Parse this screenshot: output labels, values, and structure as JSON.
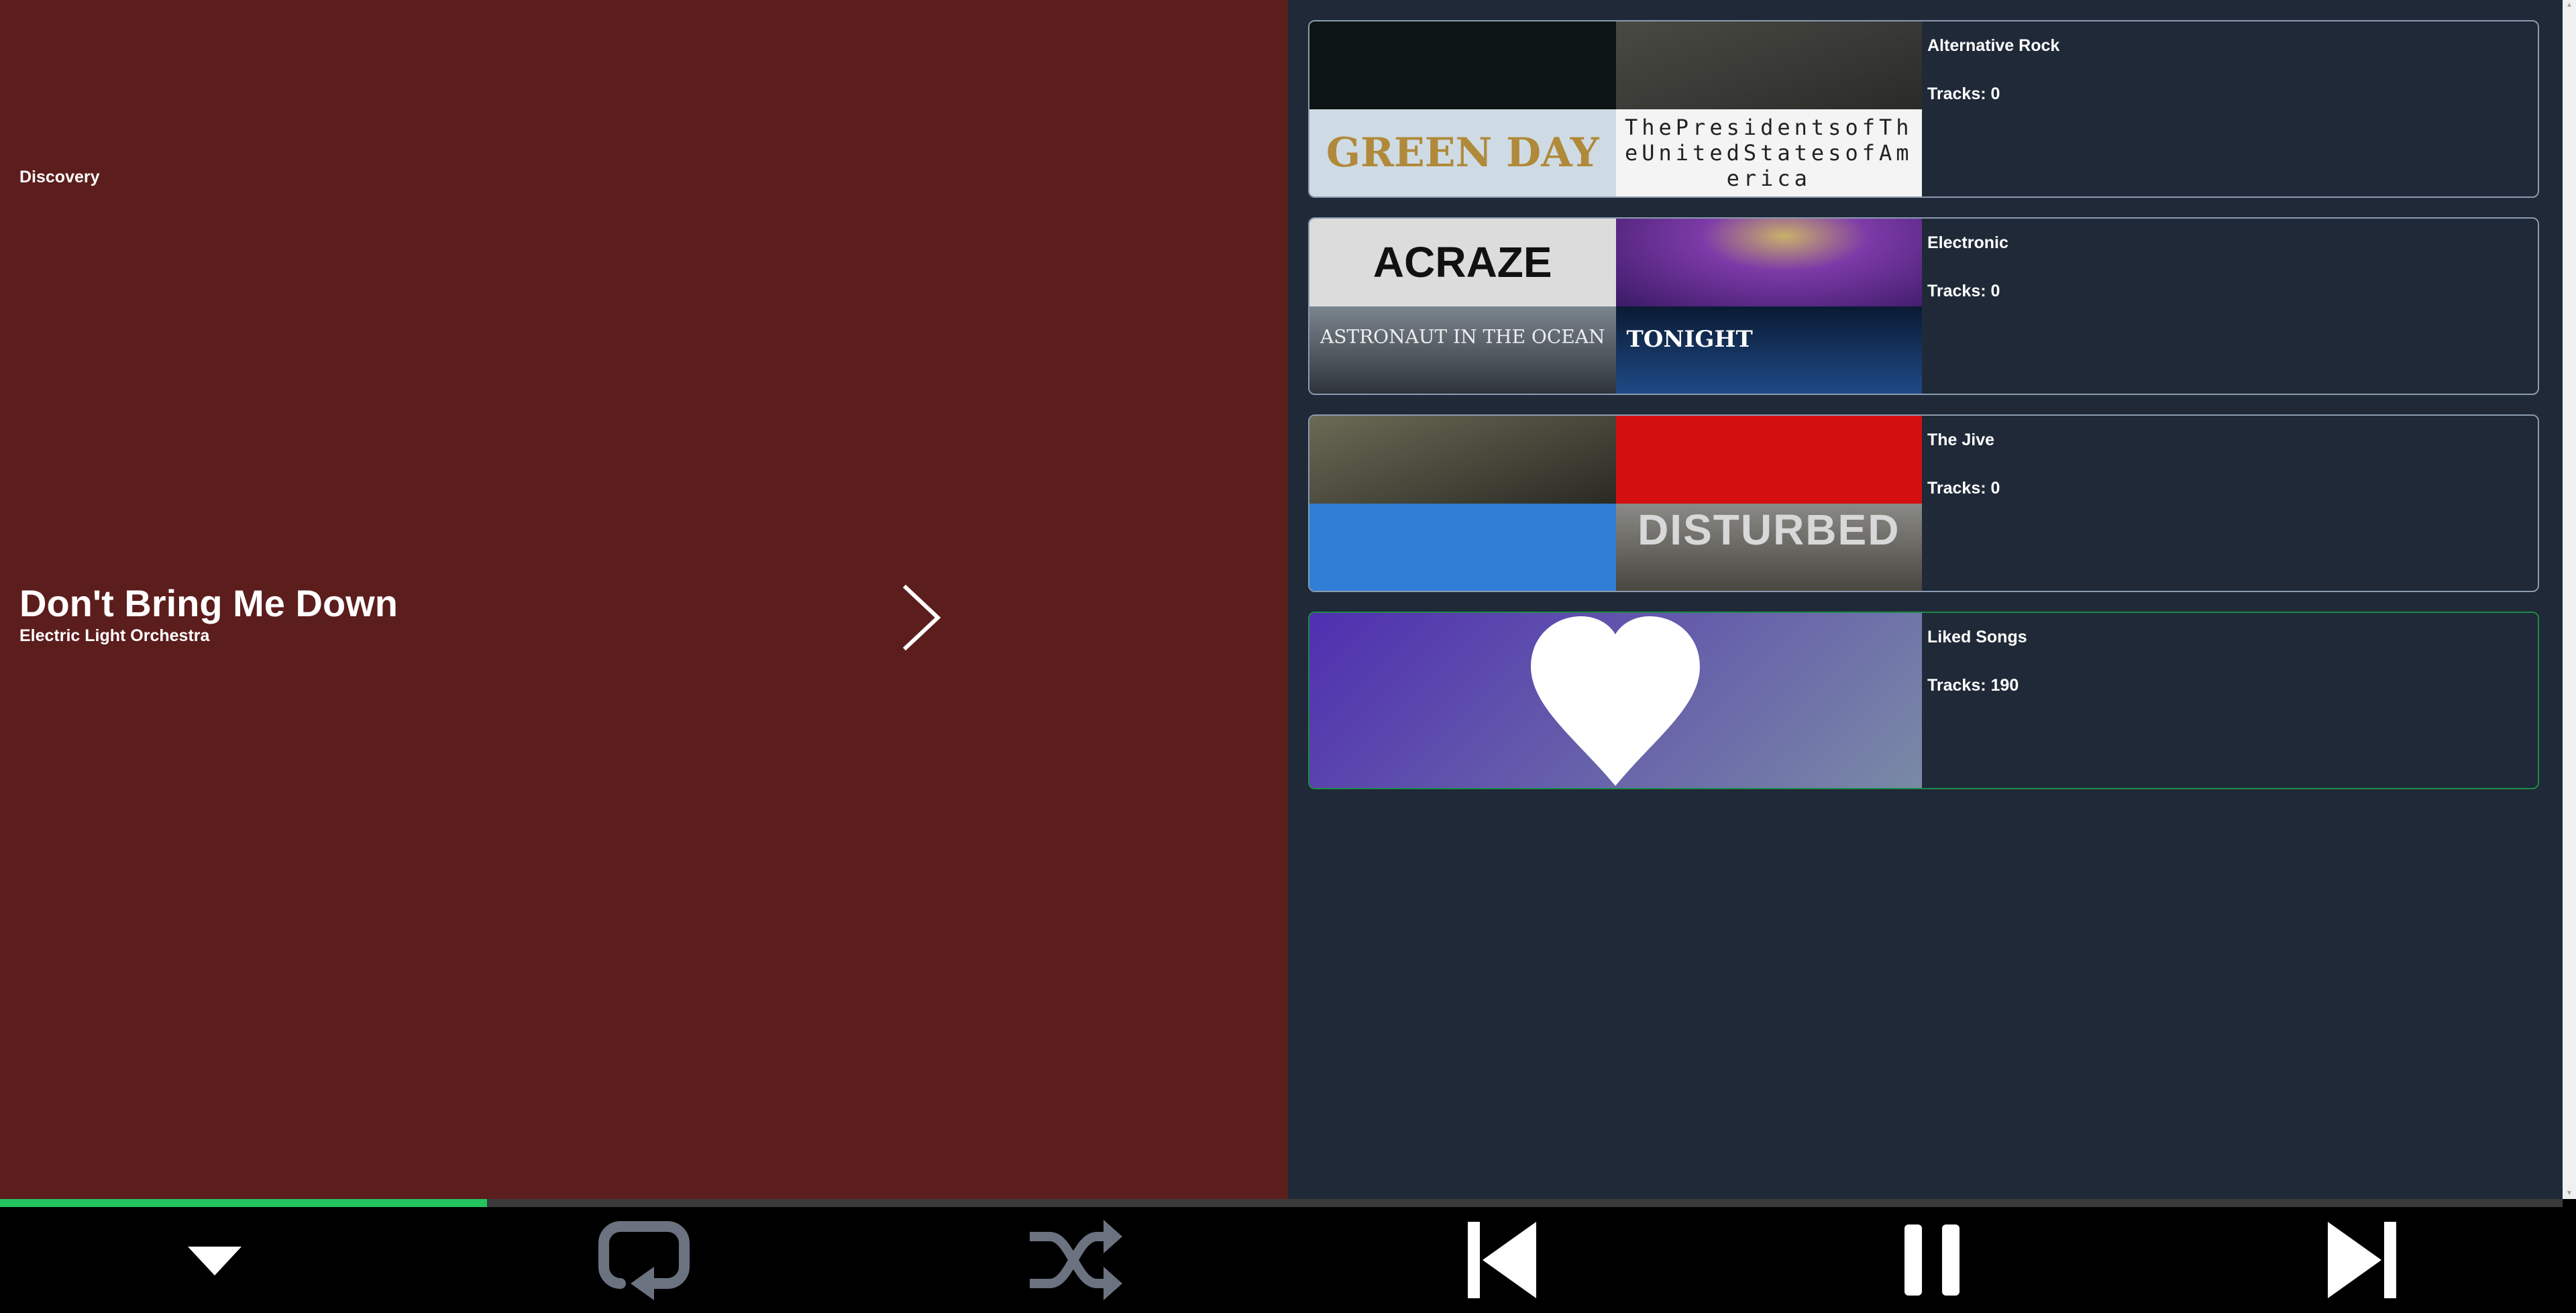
{
  "now_playing": {
    "section_label": "Discovery",
    "title": "Don't Bring Me Down",
    "artist": "Electric Light Orchestra",
    "next_icon": "chevron-right-icon",
    "background_color": "#5c1d1d"
  },
  "playlists": [
    {
      "name": "Alternative Rock",
      "tracks_label": "Tracks: 0",
      "tiles": [
        {
          "color": "#0c1414",
          "text": ""
        },
        {
          "color": "#3a3a36",
          "text": ""
        },
        {
          "color": "#cfdbe4",
          "text": "GREEN DAY"
        },
        {
          "color": "#f4f4f4",
          "text": "ThePresidentsofTheUnitedStatesofAmerica"
        }
      ]
    },
    {
      "name": "Electronic",
      "tracks_label": "Tracks: 0",
      "tiles": [
        {
          "color": "#dcdcdc",
          "text": "ACRAZE"
        },
        {
          "color": "#5a2a86",
          "text": ""
        },
        {
          "color": "#5c6670",
          "text": "ASTRONAUT IN THE OCEAN"
        },
        {
          "color": "#0d2b56",
          "text": "TONIGHT"
        }
      ]
    },
    {
      "name": "The Jive",
      "tracks_label": "Tracks: 0",
      "tiles": [
        {
          "color": "#3a3a30",
          "text": ""
        },
        {
          "color": "#d40f0f",
          "text": ""
        },
        {
          "color": "#2f7fd6",
          "text": ""
        },
        {
          "color": "#6c6a64",
          "text": "DISTURBED"
        }
      ]
    },
    {
      "name": "Liked Songs",
      "tracks_label": "Tracks: 190",
      "liked": true,
      "cover_icon": "heart-icon",
      "gradient": [
        "#4f2fb0",
        "#7a8aa6"
      ]
    }
  ],
  "playback": {
    "progress_fraction": 0.19,
    "progress_color": "#22c55e",
    "buttons": [
      "collapse-icon",
      "repeat-icon",
      "shuffle-icon",
      "previous-icon",
      "pause-icon",
      "next-track-icon"
    ]
  }
}
